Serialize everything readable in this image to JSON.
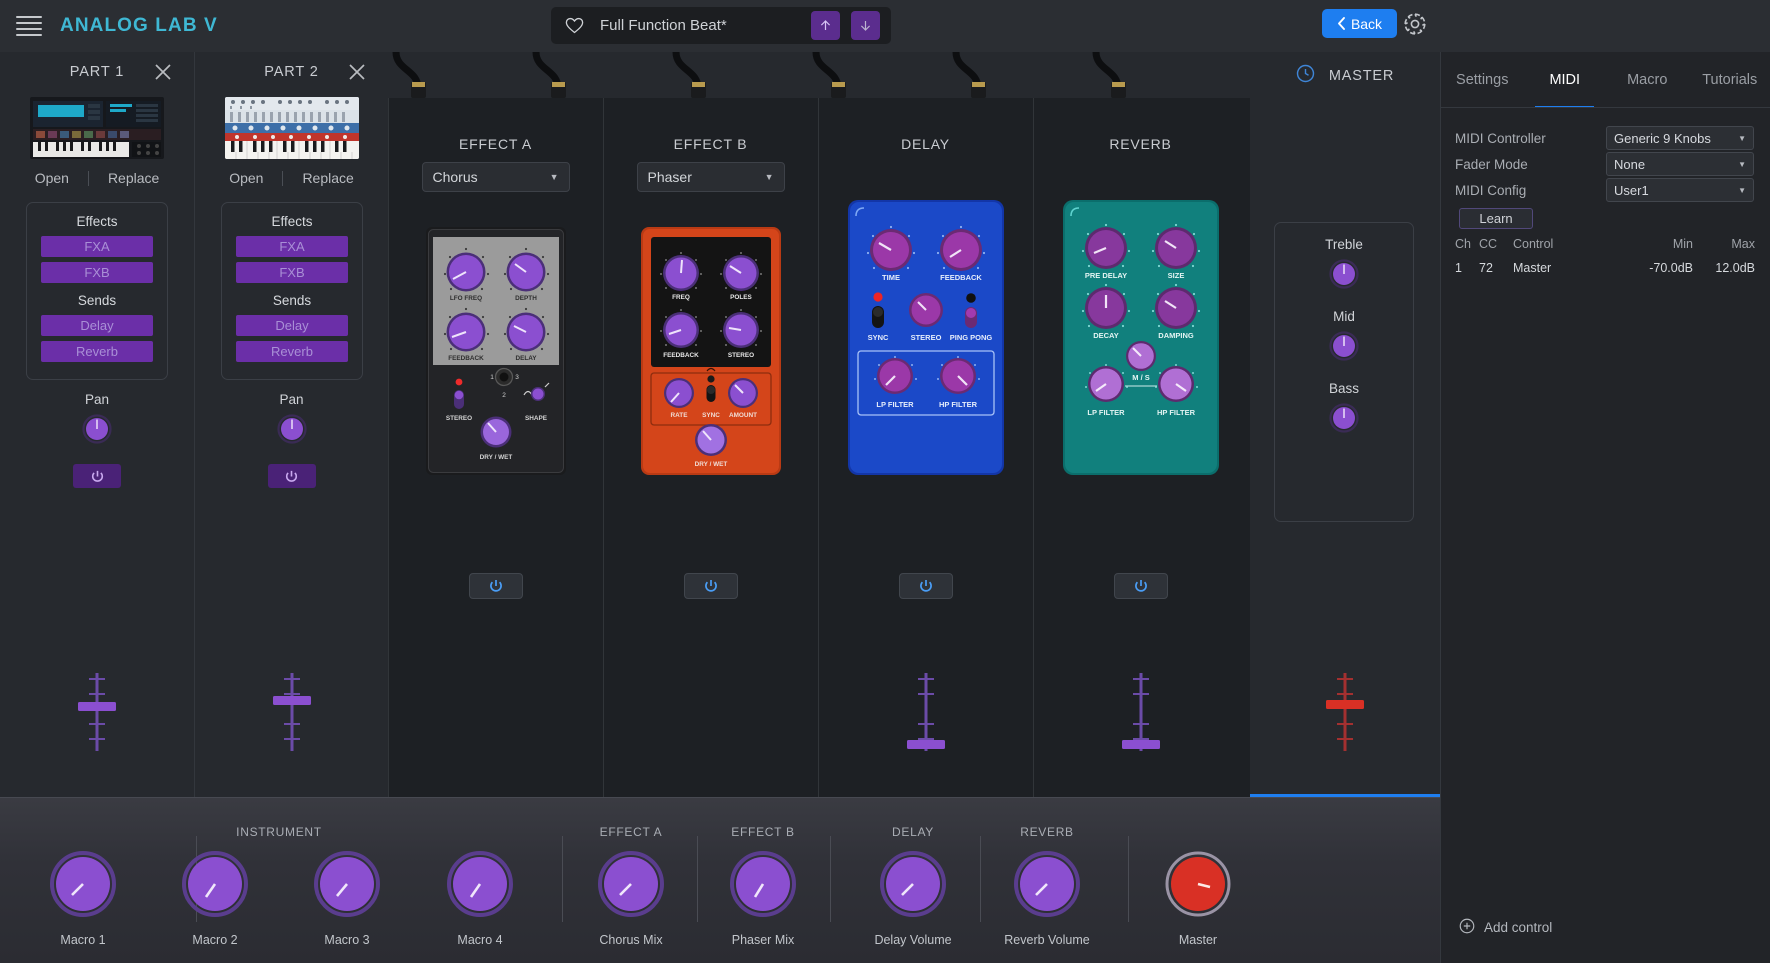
{
  "header": {
    "logo": "ANALOG LAB V",
    "menu_icon": "hamburger-icon",
    "preset_name": "Full Function Beat*",
    "favorite_icon": "heart-icon",
    "prev_label": "↑",
    "next_label": "↓",
    "back_label": "Back",
    "settings_icon": "gear-icon"
  },
  "parts": [
    {
      "title": "PART 1",
      "open_label": "Open",
      "replace_label": "Replace",
      "effects_label": "Effects",
      "fxa_label": "FXA",
      "fxb_label": "FXB",
      "sends_label": "Sends",
      "delay_label": "Delay",
      "reverb_label": "Reverb",
      "pan_label": "Pan",
      "close_icon": "close-icon",
      "power_icon": "power-icon"
    },
    {
      "title": "PART 2",
      "open_label": "Open",
      "replace_label": "Replace",
      "effects_label": "Effects",
      "fxa_label": "FXA",
      "fxb_label": "FXB",
      "sends_label": "Sends",
      "delay_label": "Delay",
      "reverb_label": "Reverb",
      "pan_label": "Pan",
      "close_icon": "close-icon",
      "power_icon": "power-icon"
    }
  ],
  "rack": {
    "slots": [
      {
        "title": "EFFECT A",
        "selected": "Chorus",
        "pedal_color": "#9a9a9a",
        "knobs": [
          "LFO FREQ",
          "DEPTH",
          "FEEDBACK",
          "DELAY",
          "DRY / WET"
        ],
        "controls": [
          "STEREO",
          "SHAPE"
        ],
        "switch_positions": [
          "1",
          "2",
          "3"
        ]
      },
      {
        "title": "EFFECT B",
        "selected": "Phaser",
        "pedal_color": "#d4451a",
        "knobs": [
          "FREQ",
          "POLES",
          "FEEDBACK",
          "STEREO",
          "RATE",
          "AMOUNT",
          "DRY / WET"
        ],
        "controls": [
          "SYNC"
        ],
        "switch_positions": []
      },
      {
        "title": "DELAY",
        "selected": "",
        "pedal_color": "#1b49c8",
        "knobs": [
          "TIME",
          "FEEDBACK",
          "STEREO",
          "LP FILTER",
          "HP FILTER"
        ],
        "controls": [
          "SYNC",
          "PING PONG"
        ],
        "switch_positions": []
      },
      {
        "title": "REVERB",
        "selected": "",
        "pedal_color": "#0f8a87",
        "knobs": [
          "PRE DELAY",
          "SIZE",
          "DECAY",
          "DAMPING",
          "LP FILTER",
          "HP FILTER"
        ],
        "controls": [
          "M / S"
        ],
        "switch_positions": []
      }
    ]
  },
  "master": {
    "title": "MASTER",
    "clock_icon": "clock-icon",
    "eq": [
      {
        "label": "Treble"
      },
      {
        "label": "Mid"
      },
      {
        "label": "Bass"
      }
    ]
  },
  "right_panel": {
    "tabs": [
      {
        "label": "Settings",
        "active": false
      },
      {
        "label": "MIDI",
        "active": true
      },
      {
        "label": "Macro",
        "active": false
      },
      {
        "label": "Tutorials",
        "active": false
      }
    ],
    "fields": [
      {
        "label": "MIDI Controller",
        "value": "Generic 9 Knobs"
      },
      {
        "label": "Fader Mode",
        "value": "None"
      },
      {
        "label": "MIDI Config",
        "value": "User1"
      }
    ],
    "learn_label": "Learn",
    "table": {
      "headers": [
        "Ch",
        "CC",
        "Control",
        "Min",
        "Max"
      ],
      "rows": [
        {
          "ch": "1",
          "cc": "72",
          "control": "Master",
          "min": "-70.0dB",
          "max": "12.0dB"
        }
      ]
    },
    "add_control_label": "Add control",
    "add_icon": "plus-circle-icon"
  },
  "macro_bar": {
    "groups": [
      {
        "label": "INSTRUMENT"
      },
      {
        "label": "EFFECT A"
      },
      {
        "label": "EFFECT B"
      },
      {
        "label": "DELAY"
      },
      {
        "label": "REVERB"
      }
    ],
    "knobs": [
      {
        "label": "Macro 1",
        "color": "#8b4fd0"
      },
      {
        "label": "Macro 2",
        "color": "#8b4fd0"
      },
      {
        "label": "Macro 3",
        "color": "#8b4fd0"
      },
      {
        "label": "Macro 4",
        "color": "#8b4fd0"
      },
      {
        "label": "Chorus Mix",
        "color": "#8b4fd0"
      },
      {
        "label": "Phaser Mix",
        "color": "#8b4fd0"
      },
      {
        "label": "Delay Volume",
        "color": "#8b4fd0"
      },
      {
        "label": "Reverb Volume",
        "color": "#8b4fd0"
      },
      {
        "label": "Master",
        "color": "#d93025"
      }
    ]
  },
  "colors": {
    "accent_blue": "#1e7ef0",
    "brand_cyan": "#3fb8d4",
    "purple": "#6b2fa8",
    "knob_purple": "#8b4fd0"
  }
}
